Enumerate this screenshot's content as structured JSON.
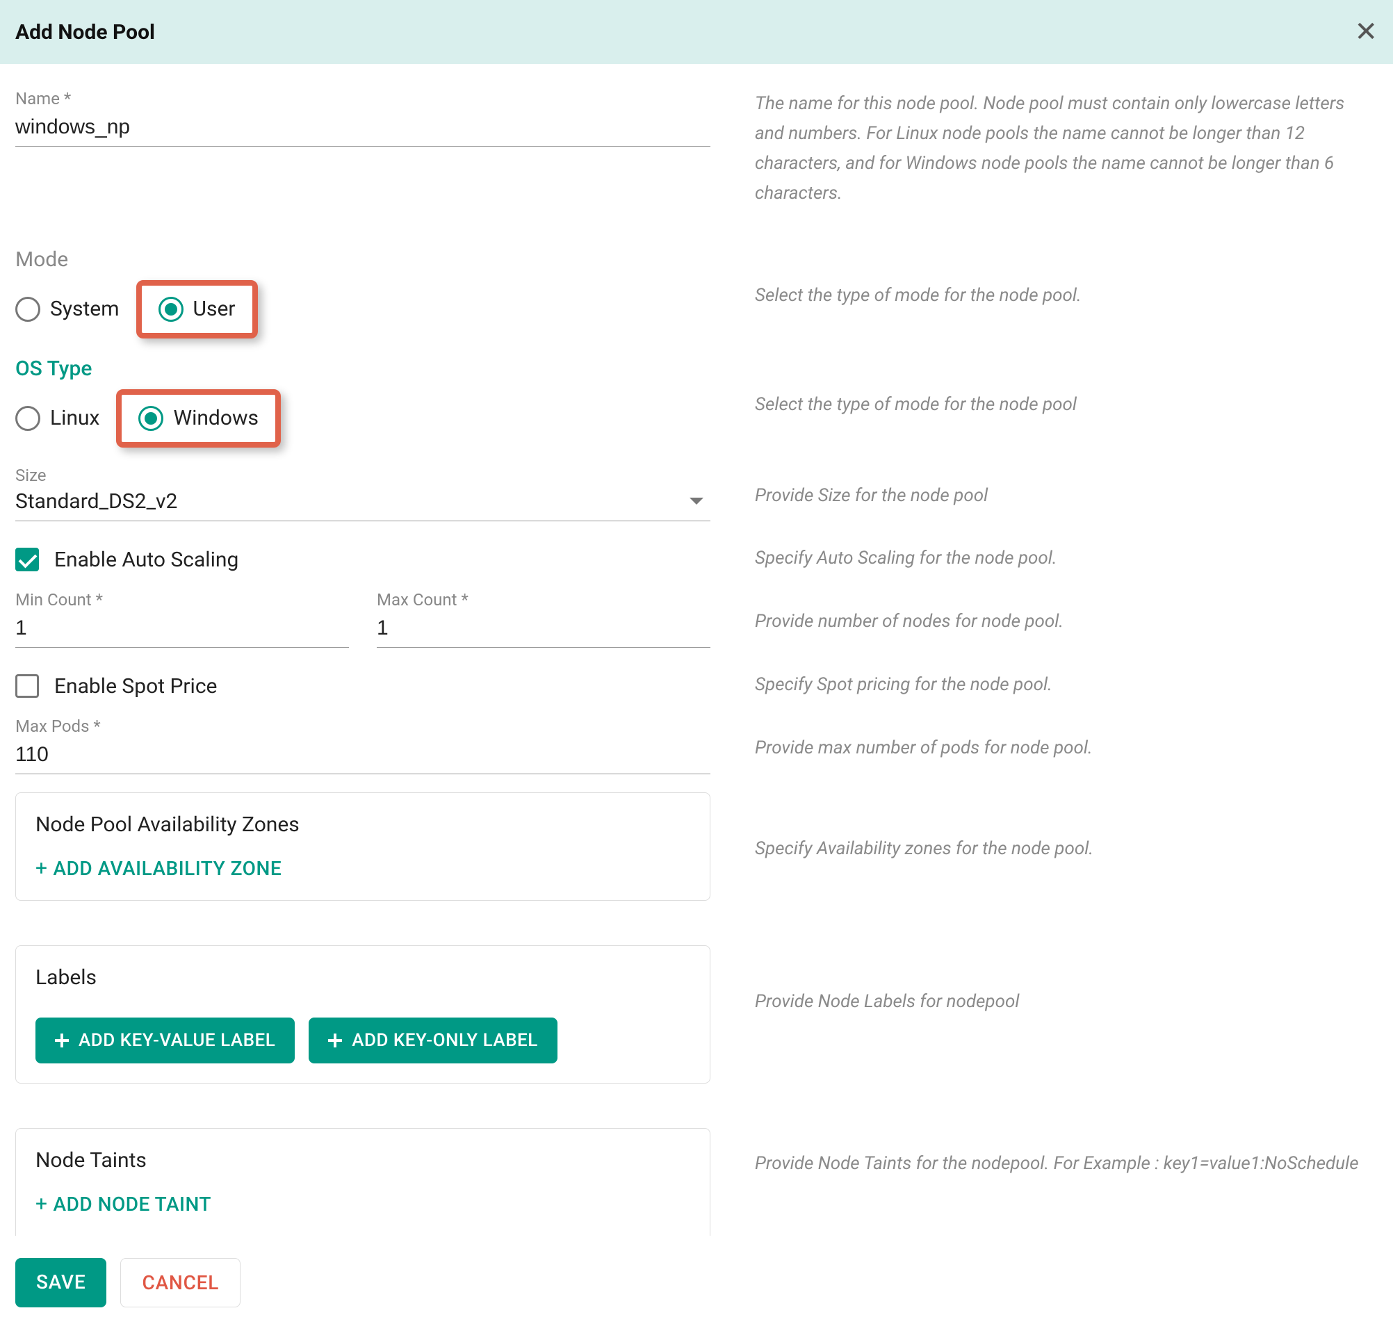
{
  "header": {
    "title": "Add Node Pool"
  },
  "name": {
    "label": "Name *",
    "value": "windows_np",
    "help": "The name for this node pool. Node pool must contain only lowercase letters and numbers. For Linux node pools the name cannot be longer than 12 characters, and for Windows node pools the name cannot be longer than 6 characters."
  },
  "mode": {
    "label": "Mode",
    "options": {
      "system": "System",
      "user": "User"
    },
    "selected": "user",
    "help": "Select the type of mode for the node pool."
  },
  "os_type": {
    "label": "OS Type",
    "options": {
      "linux": "Linux",
      "windows": "Windows"
    },
    "selected": "windows",
    "help": "Select the type of mode for the node pool"
  },
  "size": {
    "label": "Size",
    "value": "Standard_DS2_v2",
    "help": "Provide Size for the node pool"
  },
  "auto_scaling": {
    "label": "Enable Auto Scaling",
    "checked": true,
    "help": "Specify Auto Scaling for the node pool."
  },
  "min_count": {
    "label": "Min Count *",
    "value": "1"
  },
  "max_count": {
    "label": "Max Count *",
    "value": "1"
  },
  "count_help": "Provide number of nodes for node pool.",
  "spot_price": {
    "label": "Enable Spot Price",
    "checked": false,
    "help": "Specify Spot pricing for the node pool."
  },
  "max_pods": {
    "label": "Max Pods *",
    "value": "110",
    "help": "Provide max number of pods for node pool."
  },
  "availability": {
    "title": "Node Pool Availability Zones",
    "add_label": "ADD  AVAILABILITY ZONE",
    "help": "Specify Availability zones for the node pool."
  },
  "labels": {
    "title": "Labels",
    "add_kv_label": "ADD KEY-VALUE LABEL",
    "add_k_label": "ADD KEY-ONLY LABEL",
    "help": "Provide Node Labels for nodepool"
  },
  "taints": {
    "title": "Node Taints",
    "add_label": "ADD  NODE TAINT",
    "help": "Provide Node Taints for the nodepool. For Example : key1=value1:NoSchedule"
  },
  "footer": {
    "save": "SAVE",
    "cancel": "CANCEL"
  }
}
